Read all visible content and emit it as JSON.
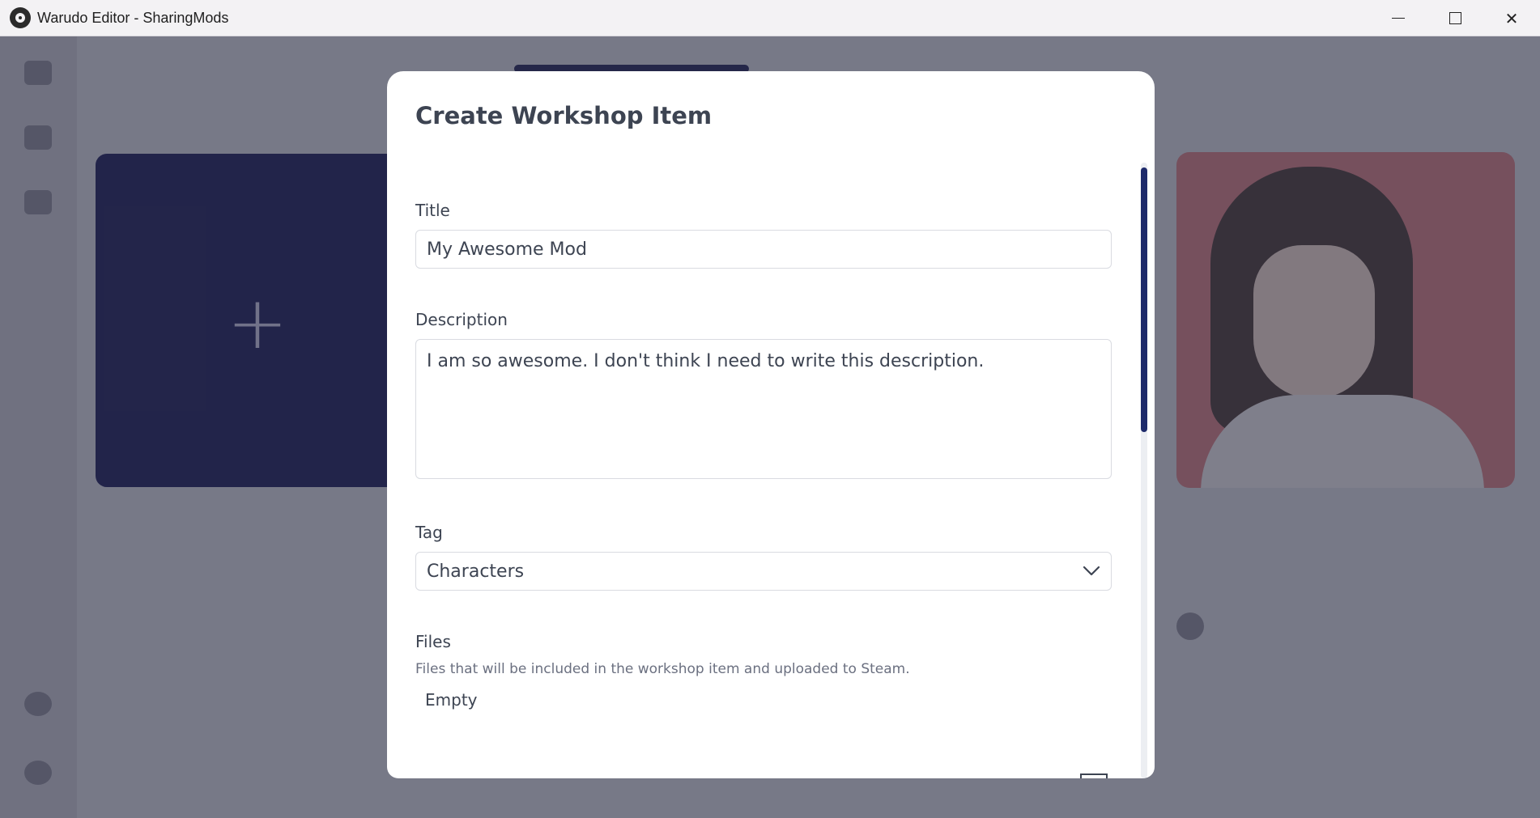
{
  "window": {
    "title": "Warudo Editor - SharingMods",
    "icons": {
      "logo": "app-logo-icon",
      "minimize": "minimize-icon",
      "maximize": "maximize-icon",
      "close": "close-icon"
    },
    "close_glyph": "✕"
  },
  "modal": {
    "title": "Create Workshop Item",
    "title_field": {
      "label": "Title",
      "value": "My Awesome Mod"
    },
    "description_field": {
      "label": "Description",
      "value": "I am so awesome. I don't think I need to write this description."
    },
    "tag_field": {
      "label": "Tag",
      "selected": "Characters",
      "icon": "chevron-down-icon"
    },
    "files_section": {
      "label": "Files",
      "help": "Files that will be included in the workshop item and uploaded to Steam.",
      "empty": "Empty"
    }
  },
  "colors": {
    "accent": "#1e2a6b",
    "create_card": "#1c1e5c",
    "avatar_background": "#d57f86"
  }
}
